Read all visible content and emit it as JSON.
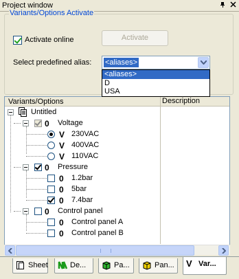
{
  "window": {
    "title": "Project window"
  },
  "group": {
    "title": "Variants/Options Activate",
    "activate_online_label": "Activate online",
    "activate_online_checked": true,
    "activate_button": "Activate",
    "alias_label": "Select predefined alias:",
    "alias_value": "<aliases>",
    "alias_options": [
      "<aliases>",
      "D",
      "USA"
    ]
  },
  "tree": {
    "col1": "Variants/Options",
    "col2": "Description",
    "root": "Untitled",
    "voltage": "Voltage",
    "v230": "230VAC",
    "v400": "400VAC",
    "v110": "110VAC",
    "pressure": "Pressure",
    "p12": "1.2bar",
    "p5": "5bar",
    "p74": "7.4bar",
    "cpanel": "Control panel",
    "cpa": "Control panel A",
    "cpb": "Control panel B",
    "glyph_v": "V",
    "glyph_o": "0"
  },
  "tabs": [
    "Sheet",
    "De...",
    "Pa...",
    "Pan...",
    "Var..."
  ]
}
